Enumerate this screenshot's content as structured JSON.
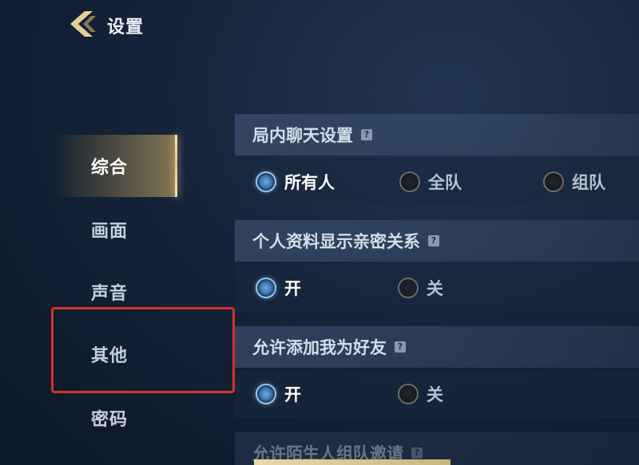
{
  "header": {
    "title": "设置"
  },
  "sidebar": {
    "items": [
      {
        "label": "综合"
      },
      {
        "label": "画面"
      },
      {
        "label": "声音"
      },
      {
        "label": "其他"
      },
      {
        "label": "密码"
      }
    ],
    "active_index": 0
  },
  "sections": [
    {
      "title": "局内聊天设置",
      "help": "?",
      "options": [
        "所有人",
        "全队",
        "组队"
      ],
      "selected": "所有人"
    },
    {
      "title": "个人资料显示亲密关系",
      "help": "?",
      "options": [
        "开",
        "关"
      ],
      "selected": "开"
    },
    {
      "title": "允许添加我为好友",
      "help": "?",
      "options": [
        "开",
        "关"
      ],
      "selected": "开"
    },
    {
      "title": "允许陌生人组队邀请",
      "help": "?"
    }
  ],
  "colors": {
    "highlight_border": "#d9302b",
    "active_accent": "#e8c982",
    "radio_selected": "#3a78b5"
  }
}
